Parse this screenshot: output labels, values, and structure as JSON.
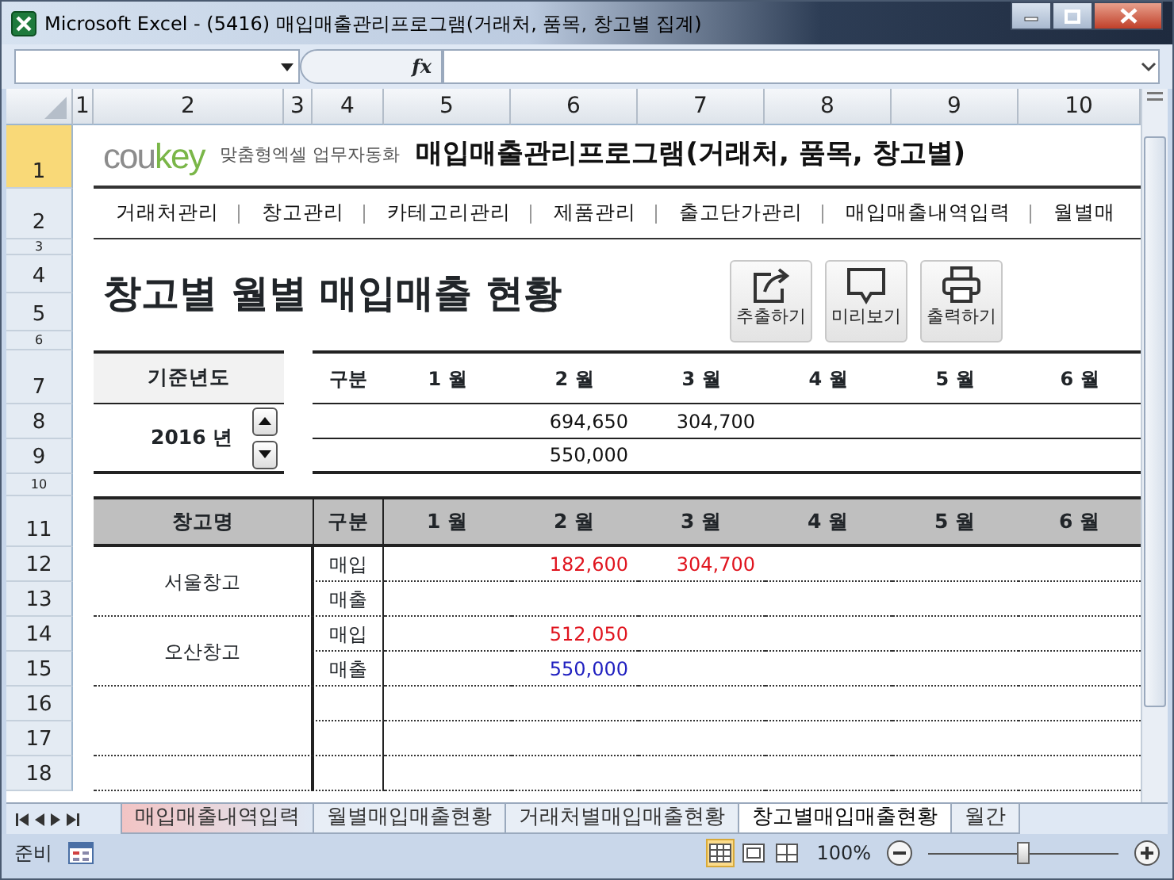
{
  "window": {
    "title": "Microsoft Excel - (5416) 매입매출관리프로그램(거래처, 품목, 창고별 집계)"
  },
  "formula_bar": {
    "function_label": "fx"
  },
  "column_headers": [
    "1",
    "2",
    "3",
    "4",
    "5",
    "6",
    "7",
    "8",
    "9",
    "10"
  ],
  "row_headers": [
    "1",
    "2",
    "3",
    "4",
    "5",
    "6",
    "7",
    "8",
    "9",
    "10",
    "11",
    "12",
    "13",
    "14",
    "15",
    "16",
    "17",
    "18"
  ],
  "brand": {
    "logo_gray": "cou",
    "logo_green": "key",
    "tagline": "맞춤형엑셀 업무자동화",
    "program_title": "매입매출관리프로그램(거래처, 품목, 창고별)"
  },
  "menu": [
    "거래처관리",
    "창고관리",
    "카테고리관리",
    "제품관리",
    "출고단가관리",
    "매입매출내역입력",
    "월별매"
  ],
  "page_title": "창고별 월별 매입매출 현황",
  "actions": [
    {
      "kind": "export",
      "label": "추출하기"
    },
    {
      "kind": "preview",
      "label": "미리보기"
    },
    {
      "kind": "print",
      "label": "출력하기"
    }
  ],
  "year_panel": {
    "label": "기준년도",
    "value": "2016 년"
  },
  "summary": {
    "columns": [
      "구분",
      "1 월",
      "2 월",
      "3 월",
      "4 월",
      "5 월",
      "6 월"
    ],
    "rows": [
      {
        "kind": "purchase",
        "values": {
          "month_2": "694,650",
          "month_3": "304,700"
        }
      },
      {
        "kind": "sales",
        "values": {
          "month_2": "550,000"
        }
      }
    ]
  },
  "detail": {
    "columns": [
      "창고명",
      "구분",
      "1 월",
      "2 월",
      "3 월",
      "4 월",
      "5 월",
      "6 월"
    ],
    "groups": [
      {
        "name": "서울창고",
        "rows": [
          {
            "kind": "purchase",
            "type": "매입",
            "values": {
              "month_2": "182,600",
              "month_3": "304,700"
            }
          },
          {
            "kind": "sales",
            "type": "매출"
          }
        ]
      },
      {
        "name": "오산창고",
        "rows": [
          {
            "kind": "purchase",
            "type": "매입",
            "values": {
              "month_2": "512,050"
            }
          },
          {
            "kind": "sales",
            "type": "매출",
            "values": {
              "month_2": "550,000"
            }
          }
        ]
      },
      {
        "rows": [
          {
            "kind": "blank"
          },
          {
            "kind": "blank"
          }
        ]
      },
      {
        "rows": [
          {
            "kind": "blank"
          }
        ]
      }
    ]
  },
  "sheet_tabs": [
    {
      "label": "매입매출내역입력",
      "selected": false,
      "color": "#f2c4c4"
    },
    {
      "label": "월별매입매출현황",
      "selected": false
    },
    {
      "label": "거래처별매입매출현황",
      "selected": false
    },
    {
      "label": "창고별매입매출현황",
      "selected": true
    },
    {
      "label": "월간",
      "selected": false
    }
  ],
  "status_bar": {
    "status": "준비",
    "zoom": "100%",
    "zoom_slider": {
      "level": 0.5
    }
  }
}
